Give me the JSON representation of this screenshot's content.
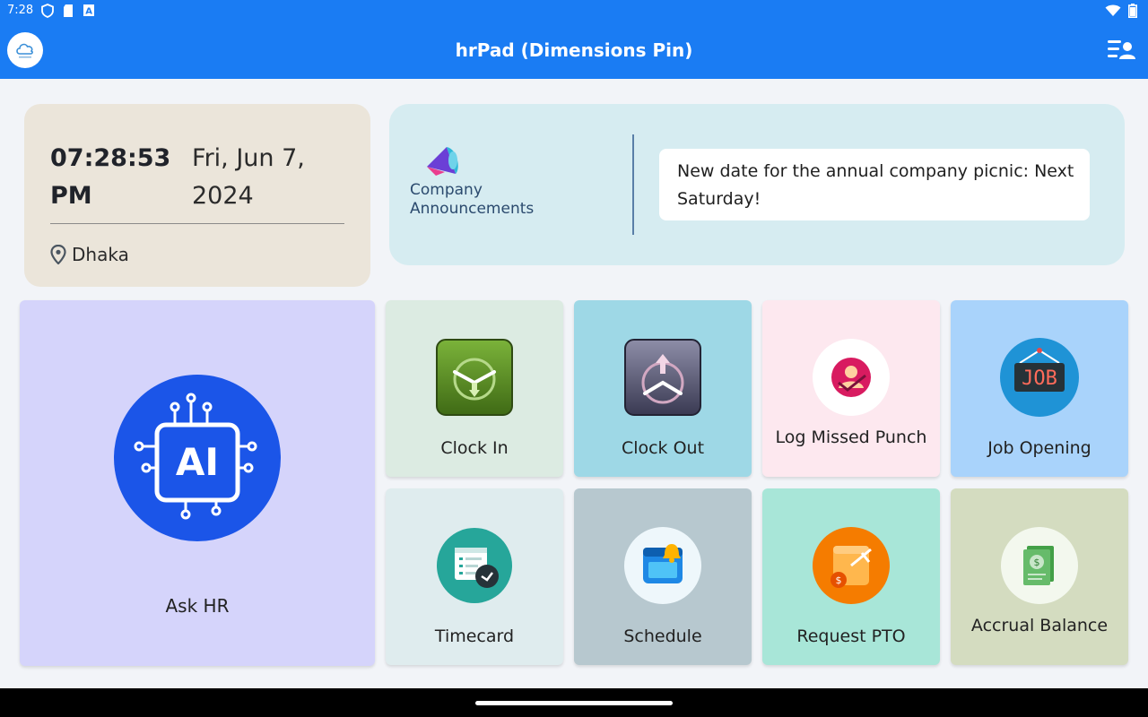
{
  "status_bar": {
    "time": "7:28"
  },
  "app": {
    "title": "hrPad (Dimensions Pin)"
  },
  "time_card": {
    "clock": "07:28:53 PM",
    "date": "Fri, Jun 7, 2024",
    "location": "Dhaka"
  },
  "announcements": {
    "label": "Company Announcements",
    "message": "New date for the annual company picnic: Next Saturday!"
  },
  "tiles": {
    "ask_hr": "Ask HR",
    "ai_badge": "AI",
    "clock_in": "Clock In",
    "clock_out": "Clock Out",
    "log_missed_punch": "Log Missed Punch",
    "job_opening": "Job Opening",
    "job_badge": "JOB",
    "timecard": "Timecard",
    "schedule": "Schedule",
    "request_pto": "Request PTO",
    "accrual_balance": "Accrual Balance"
  },
  "icons": {
    "status": [
      "shield-icon",
      "sd-card-icon",
      "font-icon",
      "wifi-icon",
      "battery-icon"
    ],
    "menu": "user-list-icon",
    "location": "location-pin-icon",
    "announcement": "megaphone-icon"
  },
  "colors": {
    "appbar": "#1a7cf3",
    "time_card": "#ebe5da",
    "announcements": "#d6ecf1",
    "ask_hr": "#d5d4fb",
    "clock_in": "#dcebe2",
    "clock_out": "#9ed8e6",
    "log_missed_punch": "#fde8ef",
    "job_opening": "#a9d3fb",
    "timecard": "#dfecee",
    "schedule": "#b7c8cf",
    "request_pto": "#a8e6d8",
    "accrual_balance": "#d4dcc0"
  }
}
